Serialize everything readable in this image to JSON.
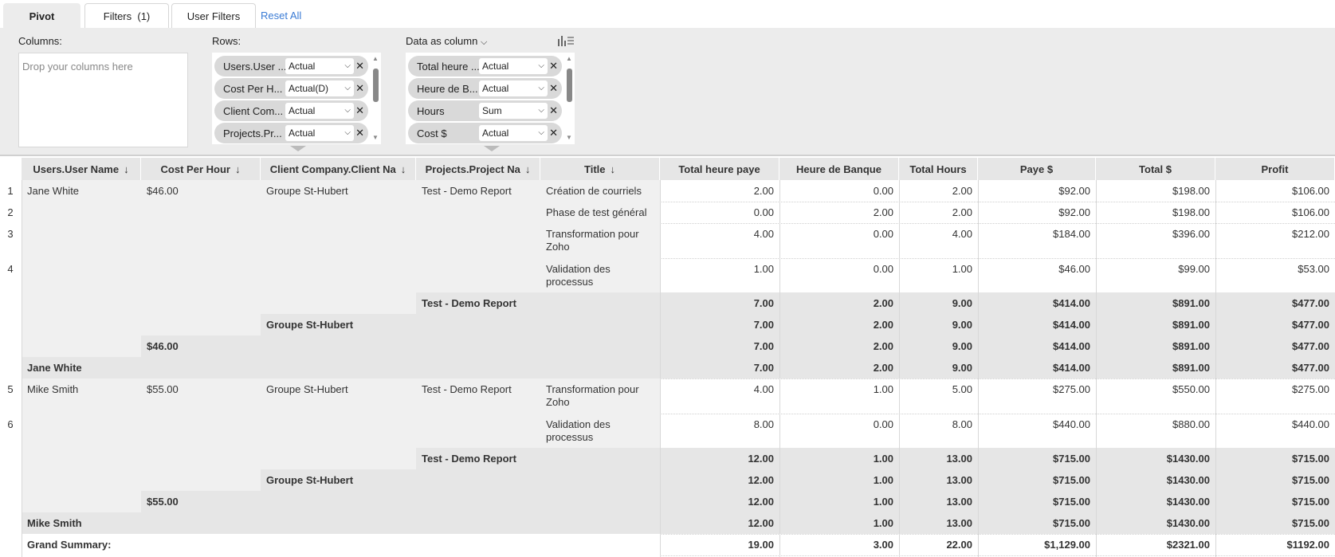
{
  "tabs": {
    "pivot": "Pivot",
    "filters": "Filters  (1)",
    "user_filters": "User Filters",
    "reset_all": "Reset All"
  },
  "config": {
    "columns_label": "Columns:",
    "columns_placeholder": "Drop your columns here",
    "rows_label": "Rows:",
    "data_as_column_label": "Data as column",
    "rows": [
      {
        "name": "Users.User ...",
        "agg": "Actual"
      },
      {
        "name": "Cost Per H...",
        "agg": "Actual(D)"
      },
      {
        "name": "Client Com...",
        "agg": "Actual"
      },
      {
        "name": "Projects.Pr...",
        "agg": "Actual"
      }
    ],
    "data_fields": [
      {
        "name": "Total heure ...",
        "agg": "Actual"
      },
      {
        "name": "Heure de B...",
        "agg": "Actual"
      },
      {
        "name": "Hours",
        "agg": "Sum"
      },
      {
        "name": "Cost $",
        "agg": "Actual"
      }
    ]
  },
  "grid": {
    "headers": [
      "Users.User Name",
      "Cost Per Hour",
      "Client Company.Client Na",
      "Projects.Project Na",
      "Title",
      "Total heure paye",
      "Heure de Banque",
      "Total Hours",
      "Paye $",
      "Total $",
      "Profit"
    ],
    "rownums": [
      "1",
      "2",
      "3",
      "4",
      "5",
      "6"
    ],
    "jane": {
      "user": "Jane White",
      "cost": "$46.00",
      "client": "Groupe St-Hubert",
      "project": "Test - Demo Report",
      "rows": [
        {
          "title1": "Création de courriels",
          "title2": "",
          "v": [
            "2.00",
            "0.00",
            "2.00",
            "$92.00",
            "$198.00",
            "$106.00"
          ]
        },
        {
          "title1": "Phase de test général",
          "title2": "",
          "v": [
            "0.00",
            "2.00",
            "2.00",
            "$92.00",
            "$198.00",
            "$106.00"
          ]
        },
        {
          "title1": "Transformation pour",
          "title2": "Zoho",
          "v": [
            "4.00",
            "0.00",
            "4.00",
            "$184.00",
            "$396.00",
            "$212.00"
          ]
        },
        {
          "title1": "Validation des",
          "title2": "processus",
          "v": [
            "1.00",
            "0.00",
            "1.00",
            "$46.00",
            "$99.00",
            "$53.00"
          ]
        }
      ],
      "subtotal_project": "Test - Demo Report",
      "subtotal_client": "Groupe St-Hubert",
      "subtotal_cost": "$46.00",
      "subtotal_user": "Jane White",
      "totals": [
        "7.00",
        "2.00",
        "9.00",
        "$414.00",
        "$891.00",
        "$477.00"
      ]
    },
    "mike": {
      "user": "Mike Smith",
      "cost": "$55.00",
      "client": "Groupe St-Hubert",
      "project": "Test - Demo Report",
      "rows": [
        {
          "title1": "Transformation pour",
          "title2": "Zoho",
          "v": [
            "4.00",
            "1.00",
            "5.00",
            "$275.00",
            "$550.00",
            "$275.00"
          ]
        },
        {
          "title1": "Validation des",
          "title2": "processus",
          "v": [
            "8.00",
            "0.00",
            "8.00",
            "$440.00",
            "$880.00",
            "$440.00"
          ]
        }
      ],
      "subtotal_project": "Test - Demo Report",
      "subtotal_client": "Groupe St-Hubert",
      "subtotal_cost": "$55.00",
      "subtotal_user": "Mike Smith",
      "totals": [
        "12.00",
        "1.00",
        "13.00",
        "$715.00",
        "$1430.00",
        "$715.00"
      ]
    },
    "grand": {
      "label": "Grand Summary:",
      "v": [
        "19.00",
        "3.00",
        "22.00",
        "$1,129.00",
        "$2321.00",
        "$1192.00"
      ]
    }
  }
}
